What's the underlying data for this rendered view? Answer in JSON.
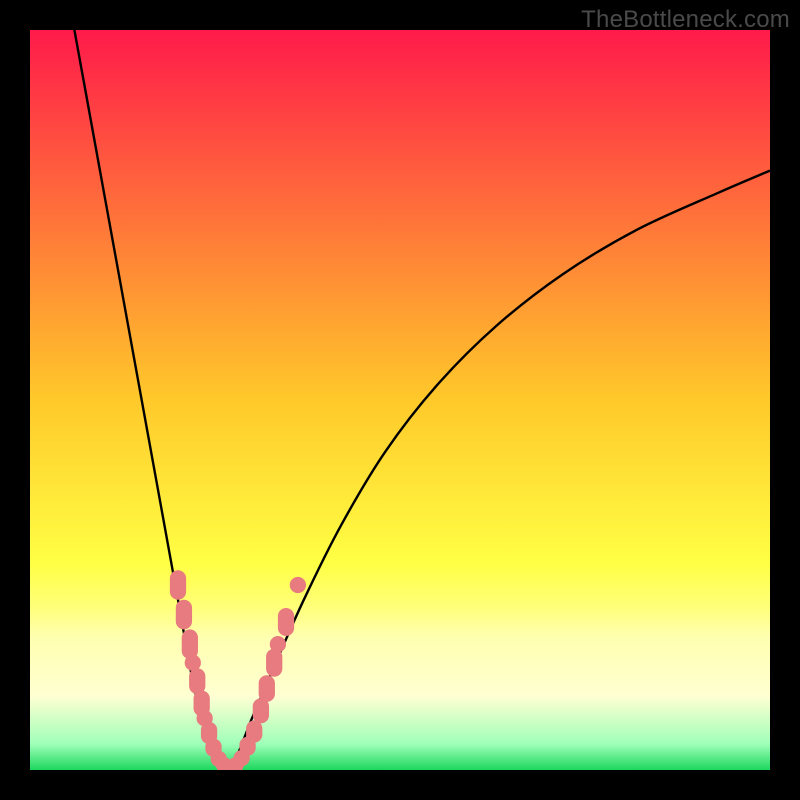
{
  "watermark": "TheBottleneck.com",
  "colors": {
    "frame": "#000000",
    "curve": "#000000",
    "marker_fill": "#e77b7f",
    "gradient_stops": [
      {
        "offset": 0.0,
        "color": "#ff1a4a"
      },
      {
        "offset": 0.5,
        "color": "#ffc92a"
      },
      {
        "offset": 0.72,
        "color": "#ffff44"
      },
      {
        "offset": 0.78,
        "color": "#ffff7a"
      },
      {
        "offset": 0.82,
        "color": "#ffffb0"
      },
      {
        "offset": 0.9,
        "color": "#ffffd2"
      },
      {
        "offset": 0.965,
        "color": "#9fffb8"
      },
      {
        "offset": 1.0,
        "color": "#1cd75e"
      }
    ]
  },
  "chart_data": {
    "type": "line",
    "title": "",
    "xlabel": "",
    "ylabel": "",
    "xlim": [
      0,
      100
    ],
    "ylim": [
      0,
      100
    ],
    "grid": false,
    "legend": false,
    "series": [
      {
        "name": "left-branch",
        "x": [
          6,
          8,
          10,
          12,
          14,
          16,
          18,
          20,
          22,
          23.5,
          25,
          26.5
        ],
        "y": [
          100,
          89,
          78,
          67,
          56,
          45,
          34,
          23,
          12,
          6,
          2,
          0
        ]
      },
      {
        "name": "right-branch",
        "x": [
          26.5,
          28,
          30,
          33,
          37,
          42,
          48,
          55,
          63,
          72,
          82,
          93,
          100
        ],
        "y": [
          0,
          2,
          7,
          14,
          23,
          33,
          43,
          52,
          60,
          67,
          73,
          78,
          81
        ]
      }
    ],
    "markers": [
      {
        "x": 20.0,
        "y": 25.0,
        "w": 2.2,
        "h": 4.0
      },
      {
        "x": 20.8,
        "y": 21.0,
        "w": 2.2,
        "h": 4.0
      },
      {
        "x": 21.6,
        "y": 17.0,
        "w": 2.2,
        "h": 4.0
      },
      {
        "x": 22.0,
        "y": 14.5,
        "w": 2.2,
        "h": 2.2
      },
      {
        "x": 22.6,
        "y": 12.0,
        "w": 2.2,
        "h": 3.5
      },
      {
        "x": 23.2,
        "y": 9.0,
        "w": 2.2,
        "h": 3.5
      },
      {
        "x": 23.6,
        "y": 7.0,
        "w": 2.2,
        "h": 2.2
      },
      {
        "x": 24.2,
        "y": 5.0,
        "w": 2.2,
        "h": 3.0
      },
      {
        "x": 24.8,
        "y": 3.0,
        "w": 2.2,
        "h": 2.5
      },
      {
        "x": 25.5,
        "y": 1.5,
        "w": 2.2,
        "h": 2.2
      },
      {
        "x": 26.2,
        "y": 0.7,
        "w": 2.2,
        "h": 2.0
      },
      {
        "x": 27.0,
        "y": 0.4,
        "w": 2.2,
        "h": 2.0
      },
      {
        "x": 27.8,
        "y": 0.7,
        "w": 2.2,
        "h": 2.0
      },
      {
        "x": 28.6,
        "y": 1.6,
        "w": 2.2,
        "h": 2.2
      },
      {
        "x": 29.4,
        "y": 3.2,
        "w": 2.2,
        "h": 2.6
      },
      {
        "x": 30.3,
        "y": 5.2,
        "w": 2.2,
        "h": 3.0
      },
      {
        "x": 31.2,
        "y": 8.0,
        "w": 2.2,
        "h": 3.4
      },
      {
        "x": 32.0,
        "y": 11.0,
        "w": 2.2,
        "h": 3.6
      },
      {
        "x": 33.0,
        "y": 14.5,
        "w": 2.2,
        "h": 3.8
      },
      {
        "x": 33.5,
        "y": 17.0,
        "w": 2.2,
        "h": 2.2
      },
      {
        "x": 34.6,
        "y": 20.0,
        "w": 2.2,
        "h": 3.8
      },
      {
        "x": 36.2,
        "y": 25.0,
        "w": 2.2,
        "h": 2.2
      }
    ]
  }
}
